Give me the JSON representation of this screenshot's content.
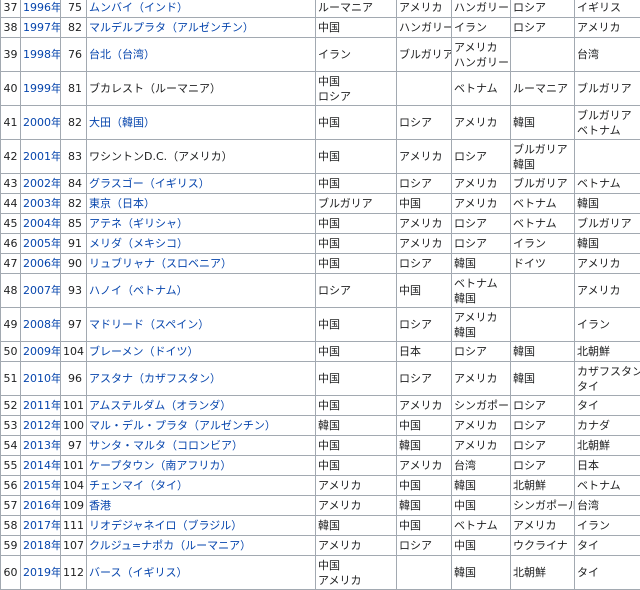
{
  "rows": [
    {
      "no": "37",
      "year": "1996年",
      "count": "75",
      "city": [
        {
          "t": "ムンバイ（インド）",
          "link": true
        }
      ],
      "c1": [
        "ルーマニア"
      ],
      "c2": [
        "アメリカ"
      ],
      "c3": [
        "ハンガリー"
      ],
      "c4": [
        "ロシア"
      ],
      "c5": [
        "イギリス"
      ]
    },
    {
      "no": "38",
      "year": "1997年",
      "count": "82",
      "city": [
        {
          "t": "マルデルプラタ（アルゼンチン）",
          "link": true
        }
      ],
      "c1": [
        "中国"
      ],
      "c2": [
        "ハンガリー"
      ],
      "c3": [
        "イラン"
      ],
      "c4": [
        "ロシア"
      ],
      "c5": [
        "アメリカ"
      ]
    },
    {
      "no": "39",
      "year": "1998年",
      "count": "76",
      "city": [
        {
          "t": "台北（台湾）",
          "link": true
        }
      ],
      "c1": [
        "イラン"
      ],
      "c2": [
        "ブルガリア"
      ],
      "c3": [
        "アメリカ",
        "ハンガリー"
      ],
      "c4": [],
      "c5": [
        "台湾"
      ]
    },
    {
      "no": "40",
      "year": "1999年",
      "count": "81",
      "city": [
        {
          "t": "ブカレスト（ルーマニア）",
          "link": false
        }
      ],
      "c1": [
        "中国",
        "ロシア"
      ],
      "c2": [],
      "c3": [
        "ベトナム"
      ],
      "c4": [
        "ルーマニア"
      ],
      "c5": [
        "ブルガリア"
      ]
    },
    {
      "no": "41",
      "year": "2000年",
      "count": "82",
      "city": [
        {
          "t": "大田（韓国）",
          "link": true
        }
      ],
      "c1": [
        "中国"
      ],
      "c2": [
        "ロシア"
      ],
      "c3": [
        "アメリカ"
      ],
      "c4": [
        "韓国"
      ],
      "c5": [
        "ブルガリア",
        "ベトナム"
      ]
    },
    {
      "no": "42",
      "year": "2001年",
      "count": "83",
      "city": [
        {
          "t": "ワシントンD.C.（アメリカ）",
          "link": false
        }
      ],
      "c1": [
        "中国"
      ],
      "c2": [
        "アメリカ"
      ],
      "c3": [
        "ロシア"
      ],
      "c4": [
        "ブルガリア",
        "韓国"
      ],
      "c5": []
    },
    {
      "no": "43",
      "year": "2002年",
      "count": "84",
      "city": [
        {
          "t": "グラスゴー（イギリス）",
          "link": true
        }
      ],
      "c1": [
        "中国"
      ],
      "c2": [
        "ロシア"
      ],
      "c3": [
        "アメリカ"
      ],
      "c4": [
        "ブルガリア"
      ],
      "c5": [
        "ベトナム"
      ]
    },
    {
      "no": "44",
      "year": "2003年",
      "count": "82",
      "city": [
        {
          "t": "東京（日本）",
          "link": true
        }
      ],
      "c1": [
        "ブルガリア"
      ],
      "c2": [
        "中国"
      ],
      "c3": [
        "アメリカ"
      ],
      "c4": [
        "ベトナム"
      ],
      "c5": [
        "韓国"
      ]
    },
    {
      "no": "45",
      "year": "2004年",
      "count": "85",
      "city": [
        {
          "t": "アテネ（ギリシャ）",
          "link": true
        }
      ],
      "c1": [
        "中国"
      ],
      "c2": [
        "アメリカ"
      ],
      "c3": [
        "ロシア"
      ],
      "c4": [
        "ベトナム"
      ],
      "c5": [
        "ブルガリア"
      ]
    },
    {
      "no": "46",
      "year": "2005年",
      "count": "91",
      "city": [
        {
          "t": "メリダ（メキシコ）",
          "link": true
        }
      ],
      "c1": [
        "中国"
      ],
      "c2": [
        "アメリカ"
      ],
      "c3": [
        "ロシア"
      ],
      "c4": [
        "イラン"
      ],
      "c5": [
        "韓国"
      ]
    },
    {
      "no": "47",
      "year": "2006年",
      "count": "90",
      "city": [
        {
          "t": "リュブリャナ（スロベニア）",
          "link": true
        }
      ],
      "c1": [
        "中国"
      ],
      "c2": [
        "ロシア"
      ],
      "c3": [
        "韓国"
      ],
      "c4": [
        "ドイツ"
      ],
      "c5": [
        "アメリカ"
      ]
    },
    {
      "no": "48",
      "year": "2007年",
      "count": "93",
      "city": [
        {
          "t": "ハノイ（ベトナム）",
          "link": true
        }
      ],
      "c1": [
        "ロシア"
      ],
      "c2": [
        "中国"
      ],
      "c3": [
        "ベトナム",
        "韓国"
      ],
      "c4": [],
      "c5": [
        "アメリカ"
      ]
    },
    {
      "no": "49",
      "year": "2008年",
      "count": "97",
      "city": [
        {
          "t": "マドリード（スペイン）",
          "link": true
        }
      ],
      "c1": [
        "中国"
      ],
      "c2": [
        "ロシア"
      ],
      "c3": [
        "アメリカ",
        "韓国"
      ],
      "c4": [],
      "c5": [
        "イラン"
      ]
    },
    {
      "no": "50",
      "year": "2009年",
      "count": "104",
      "city": [
        {
          "t": "ブレーメン（ドイツ）",
          "link": true
        }
      ],
      "c1": [
        "中国"
      ],
      "c2": [
        "日本"
      ],
      "c3": [
        "ロシア"
      ],
      "c4": [
        "韓国"
      ],
      "c5": [
        "北朝鮮"
      ]
    },
    {
      "no": "51",
      "year": "2010年",
      "count": "96",
      "city": [
        {
          "t": "アスタナ（カザフスタン）",
          "link": true
        }
      ],
      "c1": [
        "中国"
      ],
      "c2": [
        "ロシア"
      ],
      "c3": [
        "アメリカ"
      ],
      "c4": [
        "韓国"
      ],
      "c5": [
        "カザフスタン",
        "タイ"
      ]
    },
    {
      "no": "52",
      "year": "2011年",
      "count": "101",
      "city": [
        {
          "t": "アムステルダム（オランダ）",
          "link": true
        }
      ],
      "c1": [
        "中国"
      ],
      "c2": [
        "アメリカ"
      ],
      "c3": [
        "シンガポール"
      ],
      "c4": [
        "ロシア"
      ],
      "c5": [
        "タイ"
      ]
    },
    {
      "no": "53",
      "year": "2012年",
      "count": "100",
      "city": [
        {
          "t": "マル・デル・プラタ（アルゼンチン）",
          "link": true
        }
      ],
      "c1": [
        "韓国"
      ],
      "c2": [
        "中国"
      ],
      "c3": [
        "アメリカ"
      ],
      "c4": [
        "ロシア"
      ],
      "c5": [
        "カナダ"
      ]
    },
    {
      "no": "54",
      "year": "2013年",
      "count": "97",
      "city": [
        {
          "t": "サンタ・マルタ（コロンビア）",
          "link": true
        }
      ],
      "c1": [
        "中国"
      ],
      "c2": [
        "韓国"
      ],
      "c3": [
        "アメリカ"
      ],
      "c4": [
        "ロシア"
      ],
      "c5": [
        "北朝鮮"
      ]
    },
    {
      "no": "55",
      "year": "2014年",
      "count": "101",
      "city": [
        {
          "t": "ケープタウン（南アフリカ）",
          "link": true
        }
      ],
      "c1": [
        "中国"
      ],
      "c2": [
        "アメリカ"
      ],
      "c3": [
        "台湾"
      ],
      "c4": [
        "ロシア"
      ],
      "c5": [
        "日本"
      ]
    },
    {
      "no": "56",
      "year": "2015年",
      "count": "104",
      "city": [
        {
          "t": "チェンマイ（タイ）",
          "link": true
        }
      ],
      "c1": [
        "アメリカ"
      ],
      "c2": [
        "中国"
      ],
      "c3": [
        "韓国"
      ],
      "c4": [
        "北朝鮮"
      ],
      "c5": [
        "ベトナム"
      ]
    },
    {
      "no": "57",
      "year": "2016年",
      "count": "109",
      "city": [
        {
          "t": "香港",
          "link": true
        }
      ],
      "c1": [
        "アメリカ"
      ],
      "c2": [
        "韓国"
      ],
      "c3": [
        "中国"
      ],
      "c4": [
        "シンガポール"
      ],
      "c5": [
        "台湾"
      ]
    },
    {
      "no": "58",
      "year": "2017年",
      "count": "111",
      "city": [
        {
          "t": "リオデジャネイロ（ブラジル）",
          "link": true
        }
      ],
      "c1": [
        "韓国"
      ],
      "c2": [
        "中国"
      ],
      "c3": [
        "ベトナム"
      ],
      "c4": [
        "アメリカ"
      ],
      "c5": [
        "イラン"
      ]
    },
    {
      "no": "59",
      "year": "2018年",
      "count": "107",
      "city": [
        {
          "t": "クルジュ=ナポカ（ルーマニア）",
          "link": true
        }
      ],
      "c1": [
        "アメリカ"
      ],
      "c2": [
        "ロシア"
      ],
      "c3": [
        "中国"
      ],
      "c4": [
        "ウクライナ"
      ],
      "c5": [
        "タイ"
      ]
    },
    {
      "no": "60",
      "year": "2019年",
      "count": "112",
      "city": [
        {
          "t": "バース（イギリス）",
          "link": true
        }
      ],
      "c1": [
        "中国",
        "アメリカ"
      ],
      "c2": [],
      "c3": [
        "韓国"
      ],
      "c4": [
        "北朝鮮"
      ],
      "c5": [
        "タイ"
      ]
    }
  ]
}
